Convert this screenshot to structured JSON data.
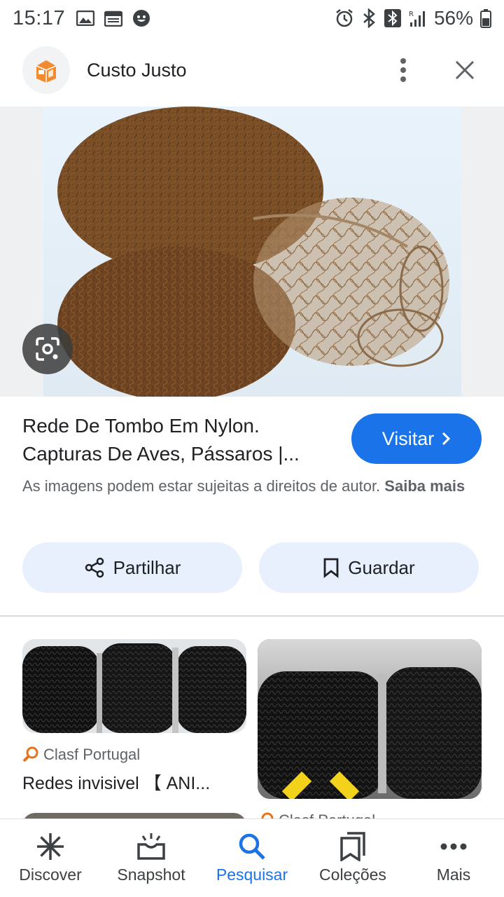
{
  "status_bar": {
    "time": "15:17",
    "battery": "56%",
    "left_icons": [
      "image-icon",
      "calendar-icon",
      "face-icon"
    ],
    "right_icons": [
      "alarm-icon",
      "bluetooth-icon",
      "bluetooth-box-icon",
      "signal-icon",
      "battery-icon"
    ]
  },
  "header": {
    "site_name": "Custo Justo",
    "logo_icon": "custo-justo-logo",
    "more_icon": "more-vert-icon",
    "close_icon": "close-icon"
  },
  "result": {
    "title": "Rede De Tombo Em Nylon. Capturas De Aves, Pássaros |...",
    "visit_label": "Visitar",
    "copyright_text": "As imagens podem estar sujeitas a direitos de autor.",
    "learn_more": "Saiba mais"
  },
  "actions": {
    "share_label": "Partilhar",
    "save_label": "Guardar"
  },
  "related": [
    {
      "source": "Clasf Portugal",
      "title": "Redes invisivel 【 ANI..."
    },
    {
      "source": "Clasf Portugal",
      "title": ""
    }
  ],
  "bottom_nav": [
    {
      "label": "Discover",
      "icon": "discover-icon",
      "active": false
    },
    {
      "label": "Snapshot",
      "icon": "snapshot-icon",
      "active": false
    },
    {
      "label": "Pesquisar",
      "icon": "search-icon",
      "active": true
    },
    {
      "label": "Coleções",
      "icon": "collections-icon",
      "active": false
    },
    {
      "label": "Mais",
      "icon": "more-horiz-icon",
      "active": false
    }
  ],
  "colors": {
    "accent": "#1a73e8",
    "action_bg": "#e8f0fe",
    "source_icon": "#e8711a"
  }
}
